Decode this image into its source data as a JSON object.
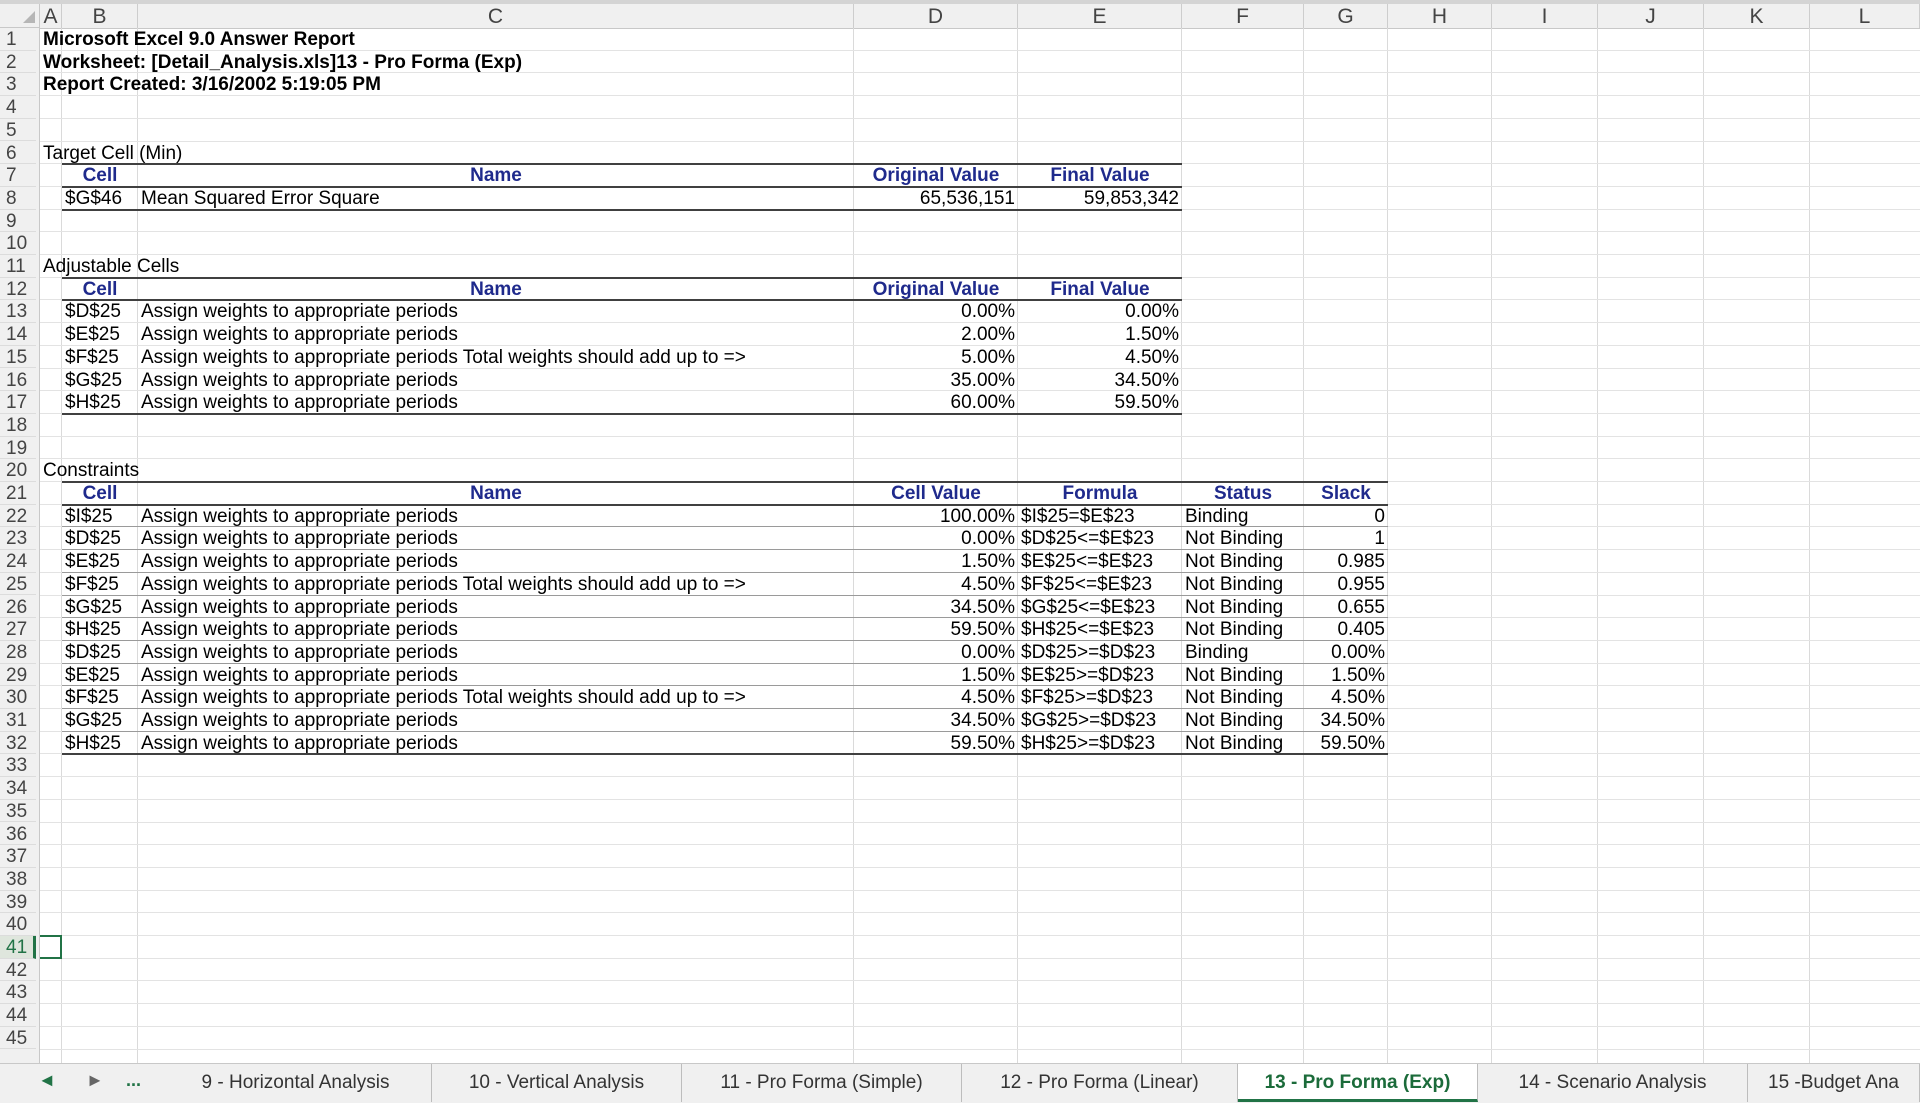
{
  "columns": [
    "A",
    "B",
    "C",
    "D",
    "E",
    "F",
    "G",
    "H",
    "I",
    "J",
    "K",
    "L"
  ],
  "rows": [
    "1",
    "2",
    "3",
    "4",
    "5",
    "6",
    "7",
    "8",
    "9",
    "10",
    "11",
    "12",
    "13",
    "14",
    "15",
    "16",
    "17",
    "18",
    "19",
    "20",
    "21",
    "22",
    "23",
    "24",
    "25",
    "26",
    "27",
    "28",
    "29",
    "30",
    "31",
    "32",
    "33",
    "34",
    "35",
    "36",
    "37",
    "38",
    "39",
    "40",
    "41",
    "42",
    "43",
    "44",
    "45"
  ],
  "report": {
    "title": "Microsoft Excel 9.0 Answer Report",
    "worksheet": "Worksheet: [Detail_Analysis.xls]13 - Pro Forma (Exp)",
    "created": "Report Created: 3/16/2002 5:19:05 PM"
  },
  "target": {
    "section": "Target Cell (Min)",
    "headers": {
      "cell": "Cell",
      "name": "Name",
      "original": "Original Value",
      "final": "Final Value"
    },
    "rows": [
      {
        "cell": "$G$46",
        "name": "Mean Squared Error  Square",
        "original": "65,536,151",
        "final": "59,853,342"
      }
    ]
  },
  "adjustable": {
    "section": "Adjustable Cells",
    "headers": {
      "cell": "Cell",
      "name": "Name",
      "original": "Original Value",
      "final": "Final Value"
    },
    "rows": [
      {
        "cell": "$D$25",
        "name": "Assign weights to appropriate periods",
        "original": "0.00%",
        "final": "0.00%"
      },
      {
        "cell": "$E$25",
        "name": "Assign weights to appropriate periods",
        "original": "2.00%",
        "final": "1.50%"
      },
      {
        "cell": "$F$25",
        "name": "Assign weights to appropriate periods Total weights should add up to =>",
        "original": "5.00%",
        "final": "4.50%"
      },
      {
        "cell": "$G$25",
        "name": "Assign weights to appropriate periods",
        "original": "35.00%",
        "final": "34.50%"
      },
      {
        "cell": "$H$25",
        "name": "Assign weights to appropriate periods",
        "original": "60.00%",
        "final": "59.50%"
      }
    ]
  },
  "constraints": {
    "section": "Constraints",
    "headers": {
      "cell": "Cell",
      "name": "Name",
      "value": "Cell Value",
      "formula": "Formula",
      "status": "Status",
      "slack": "Slack"
    },
    "rows": [
      {
        "cell": "$I$25",
        "name": "Assign weights to appropriate periods",
        "value": "100.00%",
        "formula": "$I$25=$E$23",
        "status": "Binding",
        "slack": "0"
      },
      {
        "cell": "$D$25",
        "name": "Assign weights to appropriate periods",
        "value": "0.00%",
        "formula": "$D$25<=$E$23",
        "status": "Not Binding",
        "slack": "1"
      },
      {
        "cell": "$E$25",
        "name": "Assign weights to appropriate periods",
        "value": "1.50%",
        "formula": "$E$25<=$E$23",
        "status": "Not Binding",
        "slack": "0.985"
      },
      {
        "cell": "$F$25",
        "name": "Assign weights to appropriate periods Total weights should add up to =>",
        "value": "4.50%",
        "formula": "$F$25<=$E$23",
        "status": "Not Binding",
        "slack": "0.955"
      },
      {
        "cell": "$G$25",
        "name": "Assign weights to appropriate periods",
        "value": "34.50%",
        "formula": "$G$25<=$E$23",
        "status": "Not Binding",
        "slack": "0.655"
      },
      {
        "cell": "$H$25",
        "name": "Assign weights to appropriate periods",
        "value": "59.50%",
        "formula": "$H$25<=$E$23",
        "status": "Not Binding",
        "slack": "0.405"
      },
      {
        "cell": "$D$25",
        "name": "Assign weights to appropriate periods",
        "value": "0.00%",
        "formula": "$D$25>=$D$23",
        "status": "Binding",
        "slack": "0.00%"
      },
      {
        "cell": "$E$25",
        "name": "Assign weights to appropriate periods",
        "value": "1.50%",
        "formula": "$E$25>=$D$23",
        "status": "Not Binding",
        "slack": "1.50%"
      },
      {
        "cell": "$F$25",
        "name": "Assign weights to appropriate periods Total weights should add up to =>",
        "value": "4.50%",
        "formula": "$F$25>=$D$23",
        "status": "Not Binding",
        "slack": "4.50%"
      },
      {
        "cell": "$G$25",
        "name": "Assign weights to appropriate periods",
        "value": "34.50%",
        "formula": "$G$25>=$D$23",
        "status": "Not Binding",
        "slack": "34.50%"
      },
      {
        "cell": "$H$25",
        "name": "Assign weights to appropriate periods",
        "value": "59.50%",
        "formula": "$H$25>=$D$23",
        "status": "Not Binding",
        "slack": "59.50%"
      }
    ]
  },
  "tabs": {
    "more": "...",
    "prev_icon": "triangle-left-icon",
    "next_icon": "triangle-right-icon",
    "items": [
      "9 - Horizontal Analysis",
      "10 - Vertical Analysis",
      "11 - Pro Forma (Simple)",
      "12 - Pro Forma (Linear)",
      "13 - Pro Forma (Exp)",
      "14 - Scenario Analysis",
      "15 -Budget Ana"
    ],
    "active": "13 - Pro Forma (Exp)"
  }
}
